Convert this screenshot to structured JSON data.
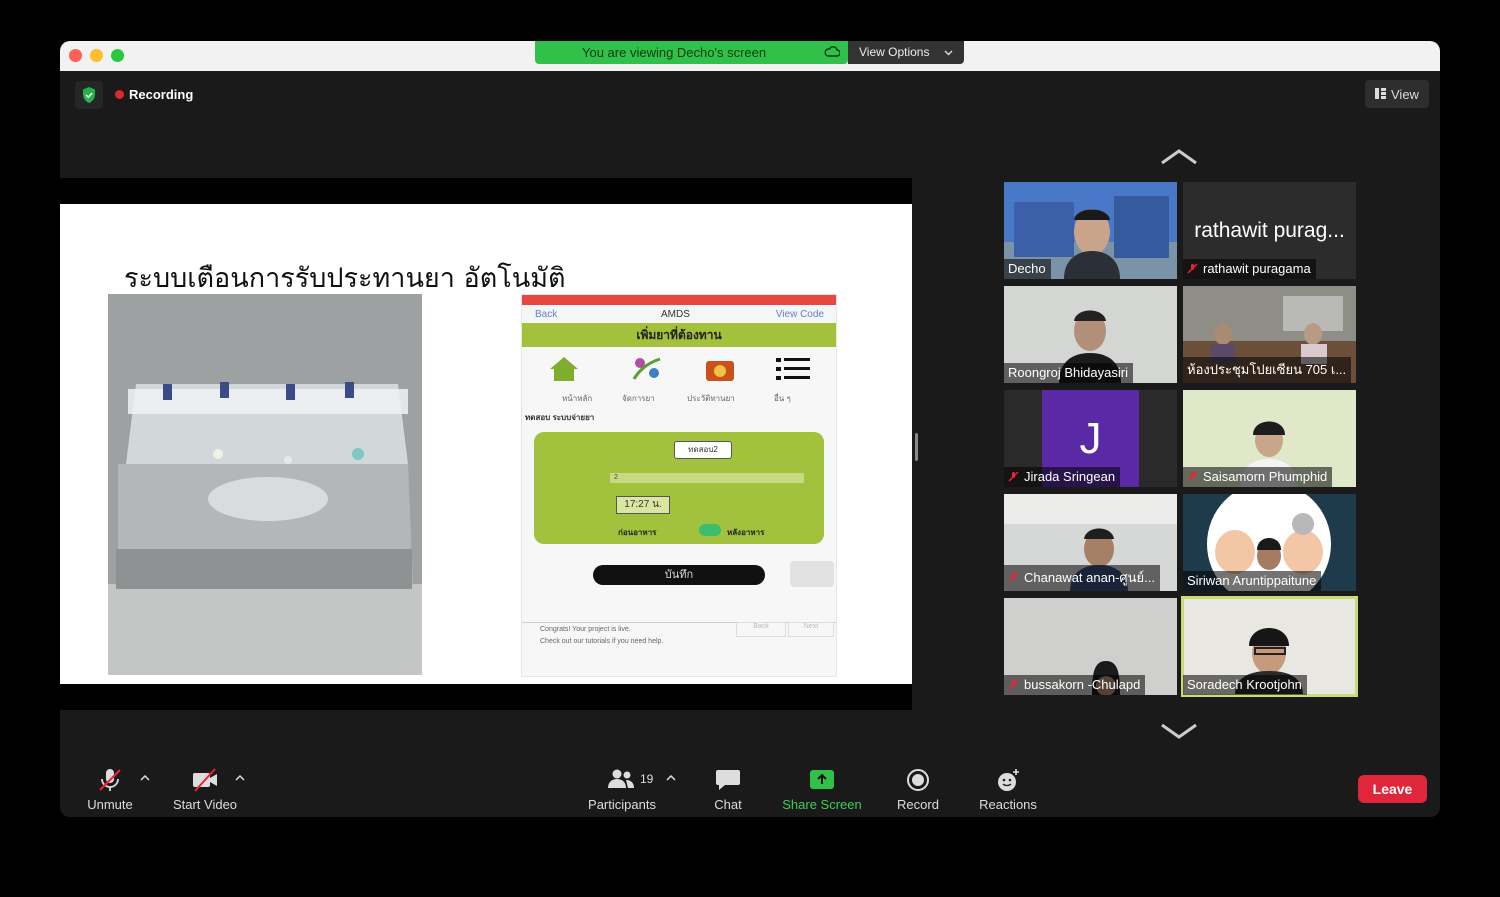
{
  "colors": {
    "accent_green": "#31c14a",
    "danger_red": "#e0263a",
    "active_speaker": "#c7dd6f"
  },
  "banner": {
    "text": "You are viewing Decho's screen",
    "view_options": "View Options"
  },
  "top": {
    "recording": "Recording",
    "view": "View"
  },
  "slide": {
    "title": "ระบบเตือนการรับประทานยา อัตโนมัติ",
    "phone": {
      "back": "Back",
      "app": "AMDS",
      "view_code": "View Code",
      "header": "เพิ่มยาที่ต้องทาน",
      "nav": [
        "หน้าหลัก",
        "จัดการยา",
        "ประวัติทานยา",
        "อื่น ๆ"
      ],
      "section": "ทดสอบ ระบบจ่ายยา",
      "med_name": "ทดสอบ2",
      "qty": "2",
      "time": "17:27 น.",
      "before": "ก่อนอาหาร",
      "after": "หลังอาหาร",
      "save": "บันทึก",
      "congrats": "Congrats! Your project is live.",
      "tutorial": "Check out our tutorials if you need help.",
      "back_btn": "Back",
      "next_btn": "Next"
    }
  },
  "participants": [
    {
      "name": "Decho",
      "muted": false
    },
    {
      "name": "rathawit puragama",
      "muted": true,
      "big": "rathawit purag..."
    },
    {
      "name": "Roongroj Bhidayasiri",
      "muted": false
    },
    {
      "name": "ห้องประชุมโปยเซียน 705 เ...",
      "muted": false
    },
    {
      "name": "Jirada Sringean",
      "muted": true,
      "initial": "J"
    },
    {
      "name": "Saisamorn Phumphid",
      "muted": true
    },
    {
      "name": "Chanawat anan-ศูนย์...",
      "muted": true
    },
    {
      "name": "Siriwan Aruntippaitune",
      "muted": false
    },
    {
      "name": "bussakorn -Chulapd",
      "muted": true
    },
    {
      "name": "Soradech Krootjohn",
      "muted": false
    }
  ],
  "toolbar": {
    "unmute": "Unmute",
    "start_video": "Start Video",
    "participants": "Participants",
    "participant_count": "19",
    "chat": "Chat",
    "share_screen": "Share Screen",
    "record": "Record",
    "reactions": "Reactions",
    "leave": "Leave"
  }
}
